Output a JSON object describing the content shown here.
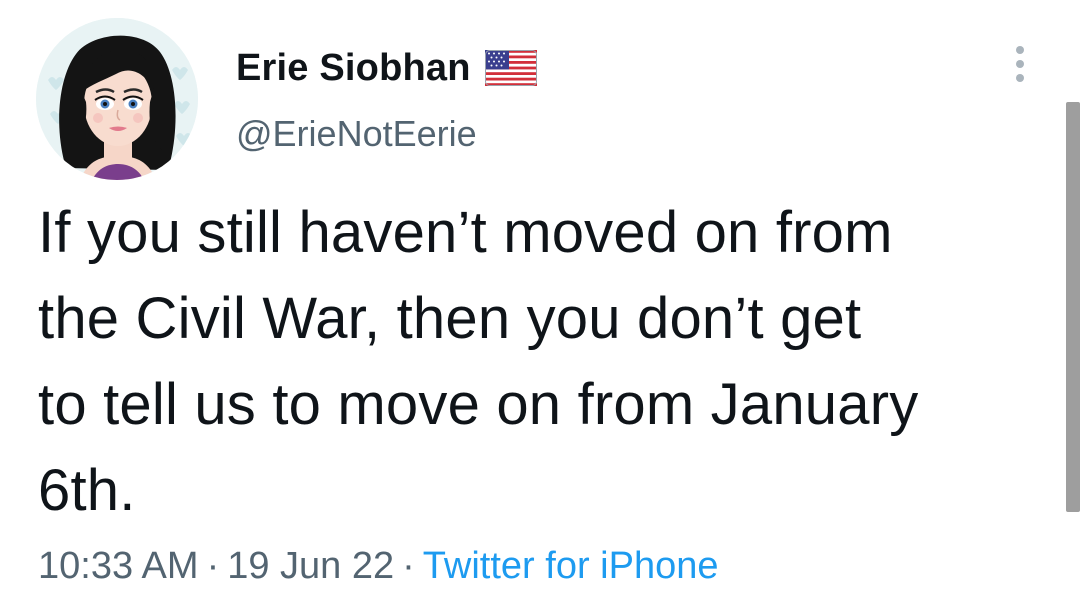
{
  "author": {
    "display_name": "Erie Siobhan",
    "handle": "@ErieNotEerie",
    "flag_icon": "us-flag-icon"
  },
  "tweet": {
    "lines": [
      "If you still haven’t moved on from",
      "the Civil War, then you don’t get",
      "to tell us to move on from January",
      "6th."
    ]
  },
  "meta": {
    "time": "10:33 AM",
    "separator": "·",
    "date": "19 Jun 22",
    "source": "Twitter for iPhone"
  },
  "colors": {
    "text_primary": "#0f1419",
    "text_secondary": "#536471",
    "link": "#1d9bf0"
  },
  "icons": {
    "more": "more-vertical-icon",
    "avatar": "cartoon-woman-avatar"
  }
}
